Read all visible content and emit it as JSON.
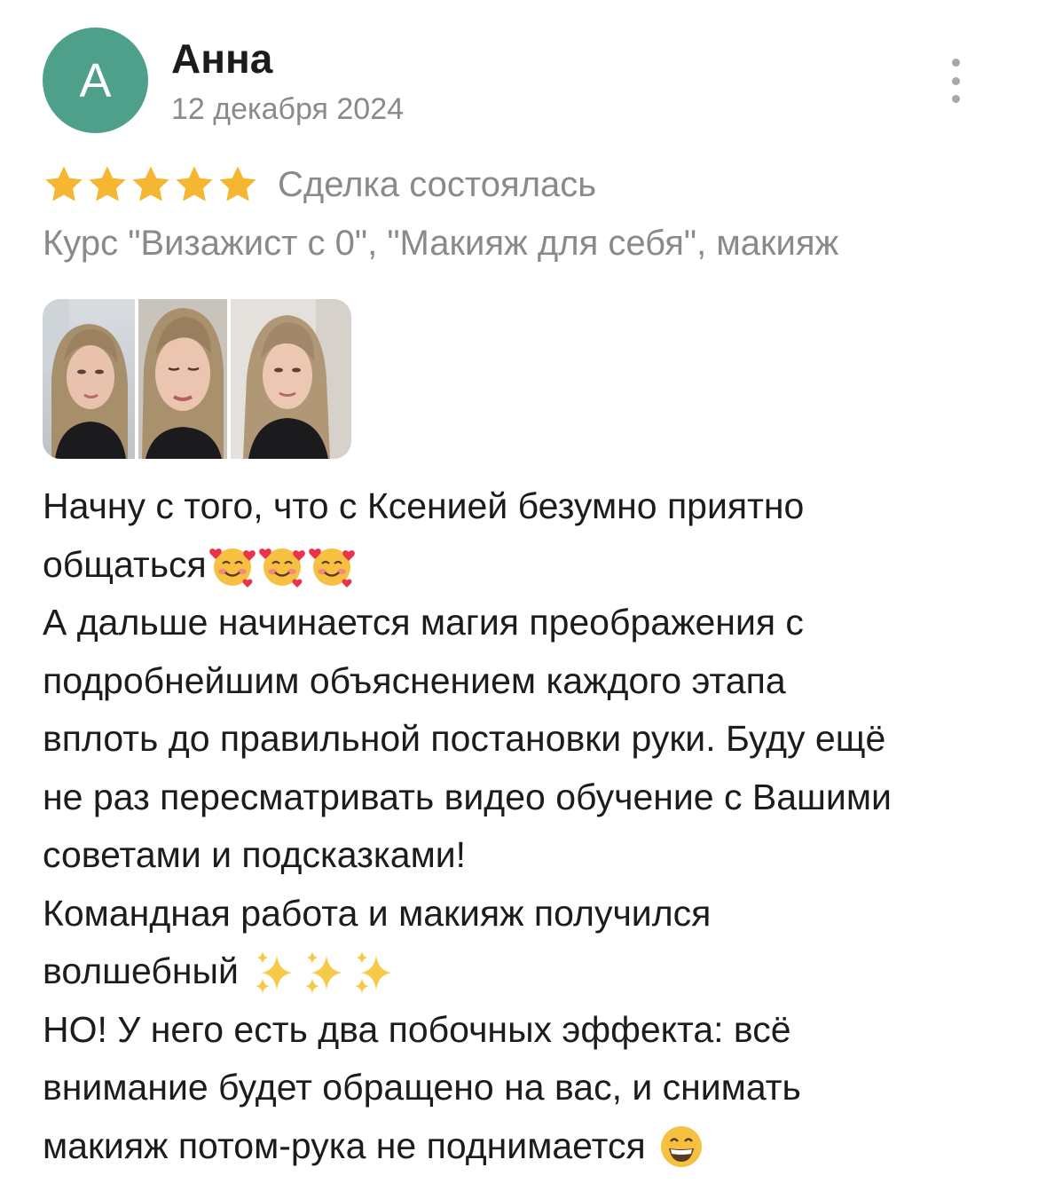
{
  "author": {
    "avatar_letter": "А",
    "avatar_color": "#4fa08a",
    "name": "Анна",
    "date": "12 декабря 2024"
  },
  "more_menu_icon": "more-vertical-icon",
  "rating": {
    "stars": 5,
    "max_stars": 5,
    "star_color": "#f5b731",
    "deal_status": "Сделка состоялась"
  },
  "course": "Курс \"Визажист с 0\", \"Макияж для себя\", макияж",
  "photos_count": 3,
  "review": {
    "line1": "Начну с того, что с Ксенией безумно приятно",
    "line2": "общаться",
    "line3": "А дальше начинается магия преображения с",
    "line4": "подробнейшим объяснением каждого этапа",
    "line5": "вплоть до правильной постановки руки. Буду ещё",
    "line6": "не раз пересматривать видео обучение с Вашими",
    "line7": "советами и подсказками!",
    "line8": "Командная работа и макияж получился",
    "line9": "волшебный",
    "line10": "НО! У него есть два побочных эффекта: всё",
    "line11": "внимание будет обращено на вас, и снимать",
    "line12": "макияж потом-рука не поднимается",
    "emoji_after_line2": [
      "smiling-face-with-hearts-icon",
      "smiling-face-with-hearts-icon",
      "smiling-face-with-hearts-icon"
    ],
    "emoji_after_line9": [
      "sparkles-icon",
      "sparkles-icon",
      "sparkles-icon"
    ],
    "emoji_after_line12": [
      "grinning-face-icon"
    ]
  }
}
